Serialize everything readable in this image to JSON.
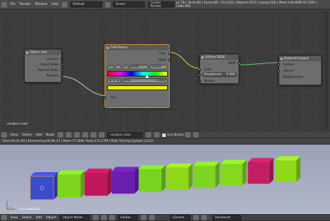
{
  "topbar": {
    "menus": [
      "File",
      "Render",
      "Window",
      "Help"
    ],
    "layout": "Default",
    "scene": "Scene",
    "engine": "Cycles Render",
    "stats": "v2.79 | Verts:80 | Faces:80 | Tris:120 | Objects:0/10 | Lamps:0/0 | Mem:140.82M (0.11M) | Cube.002"
  },
  "nodes": {
    "objinfo": {
      "title": "Object Info",
      "outputs": [
        "Location",
        "Object Index",
        "Material Index",
        "Random"
      ]
    },
    "colorramp": {
      "title": "ColorRamp",
      "outputs": [
        "Color",
        "Alpha"
      ],
      "add": "+",
      "remove": "-",
      "flip": "↔",
      "mode": "RGB",
      "interp": "Linear",
      "index_value": "2",
      "pos_label": "Pos:",
      "pos_value": "0.660",
      "input": "Fac"
    },
    "diffuse": {
      "title": "Diffuse BSDF",
      "output": "BSDF",
      "color_label": "Color",
      "roughness_label": "Roughness:",
      "roughness_value": "0.000",
      "normal": "Normal"
    },
    "matout": {
      "title": "Material Output",
      "inputs": [
        "Surface",
        "Volume",
        "Displacement"
      ]
    }
  },
  "editor_label": "random color",
  "seqheader": {
    "menus": [
      "View",
      "Select",
      "Add",
      "Node"
    ],
    "material": "random color",
    "use_nodes": "Use Nodes"
  },
  "vpheader_text": "Time:00:21.60 | Remaining:00:08.37 | Mem:77.26M, Peak:172.17M | Path Tracing Sample 23/32",
  "viewport_label": "(1) Cube.002",
  "bottombar": {
    "menus": [
      "View",
      "Select",
      "Add",
      "Object"
    ],
    "mode": "Object Mode",
    "orientation": "Global",
    "layer": "Closest",
    "render": "Rendered"
  },
  "cube_colors": [
    "#3a4cc9",
    "#7fd61f",
    "#c0175a",
    "#6a1fb0",
    "#78d420",
    "#8fd81a",
    "#7ed620",
    "#84d81e",
    "#c21f62",
    "#8fd81a"
  ],
  "ramp_colors": [
    "#ff0000",
    "#ff00ff",
    "#0000ff",
    "#00ffff",
    "#00ff00",
    "#ffff00"
  ],
  "ramp_swatch": "#f0f000"
}
